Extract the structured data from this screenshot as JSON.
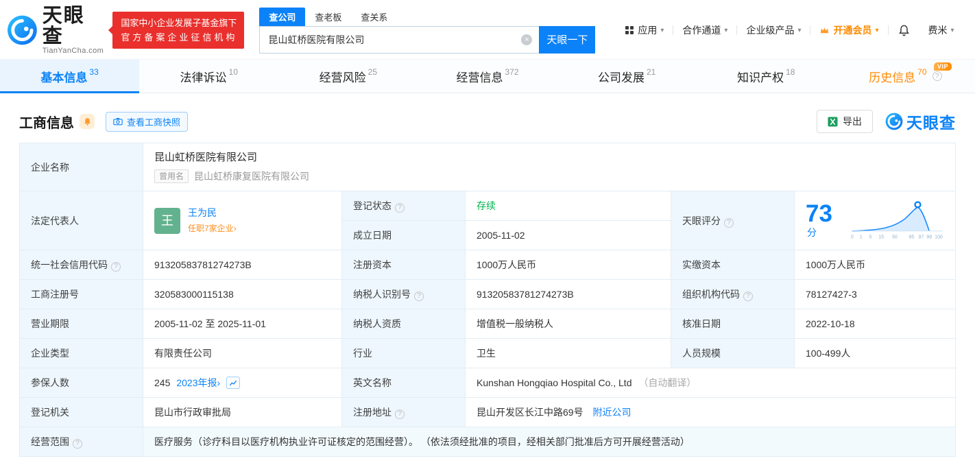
{
  "colors": {
    "accent": "#0b82f7",
    "orange": "#ff8a00",
    "green": "#00b34d",
    "red": "#e9302d"
  },
  "icons": {
    "caret_down": "▾",
    "chevron_right": "›",
    "question": "?",
    "clear": "×"
  },
  "header": {
    "brand": "天眼查",
    "brand_sub": "TianYanCha.com",
    "badge_line1": "国家中小企业发展子基金旗下",
    "badge_line2": "官方备案企业征信机构",
    "search_tabs": [
      {
        "label": "查公司"
      },
      {
        "label": "查老板"
      },
      {
        "label": "查关系"
      }
    ],
    "search_value": "昆山虹桥医院有限公司",
    "search_button": "天眼一下",
    "menu_app": "应用",
    "menu_coop": "合作通道",
    "menu_product": "企业级产品",
    "menu_vip": "开通会员",
    "menu_user": "费米"
  },
  "nav_tabs": [
    {
      "label": "基本信息",
      "count": "33"
    },
    {
      "label": "法律诉讼",
      "count": "10"
    },
    {
      "label": "经营风险",
      "count": "25"
    },
    {
      "label": "经营信息",
      "count": "372"
    },
    {
      "label": "公司发展",
      "count": "21"
    },
    {
      "label": "知识产权",
      "count": "18"
    },
    {
      "label": "历史信息",
      "count": "70",
      "vip": "VIP"
    }
  ],
  "section": {
    "title": "工商信息",
    "snapshot_button": "查看工商快照",
    "export_button": "导出",
    "watermark": "天眼查"
  },
  "table": {
    "company_name": {
      "label": "企业名称",
      "value": "昆山虹桥医院有限公司",
      "former_badge": "曾用名",
      "former_value": "昆山虹桥康复医院有限公司"
    },
    "legal_rep": {
      "label": "法定代表人",
      "avatar": "王",
      "name": "王为民",
      "link": "任职7家企业"
    },
    "reg_status": {
      "label": "登记状态",
      "value": "存续"
    },
    "est_date": {
      "label": "成立日期",
      "value": "2005-11-02"
    },
    "score": {
      "label": "天眼评分",
      "value": "73",
      "unit": "分",
      "axis": [
        "0",
        "1",
        "5",
        "15",
        "50",
        "85",
        "97",
        "99",
        "100"
      ]
    },
    "credit_code": {
      "label": "统一社会信用代码",
      "value": "91320583781274273B"
    },
    "reg_capital": {
      "label": "注册资本",
      "value": "1000万人民币"
    },
    "paid_capital": {
      "label": "实缴资本",
      "value": "1000万人民币"
    },
    "reg_no": {
      "label": "工商注册号",
      "value": "320583000115138"
    },
    "taxpayer_no": {
      "label": "纳税人识别号",
      "value": "91320583781274273B"
    },
    "org_code": {
      "label": "组织机构代码",
      "value": "78127427-3"
    },
    "business_term": {
      "label": "营业期限",
      "value": "2005-11-02 至 2025-11-01"
    },
    "taxpayer_quality": {
      "label": "纳税人资质",
      "value": "增值税一般纳税人"
    },
    "approve_date": {
      "label": "核准日期",
      "value": "2022-10-18"
    },
    "company_type": {
      "label": "企业类型",
      "value": "有限责任公司"
    },
    "industry": {
      "label": "行业",
      "value": "卫生"
    },
    "staff_size": {
      "label": "人员规模",
      "value": "100-499人"
    },
    "insured": {
      "label": "参保人数",
      "value": "245",
      "link": "2023年报"
    },
    "english_name": {
      "label": "英文名称",
      "value": "Kunshan Hongqiao Hospital Co., Ltd",
      "note": "（自动翻译）"
    },
    "reg_authority": {
      "label": "登记机关",
      "value": "昆山市行政审批局"
    },
    "address": {
      "label": "注册地址",
      "value": "昆山开发区长江中路69号",
      "link": "附近公司"
    },
    "business_scope": {
      "label": "经营范围",
      "value": "医疗服务（诊疗科目以医疗机构执业许可证核定的范围经营）。 （依法须经批准的项目，经相关部门批准后方可开展经营活动）"
    }
  }
}
